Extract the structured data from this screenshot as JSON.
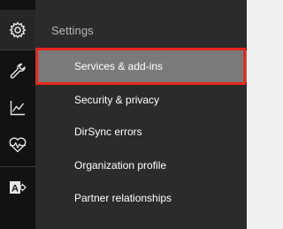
{
  "rail": {
    "items": [
      {
        "icon": "gear-icon"
      },
      {
        "icon": "wrench-icon"
      },
      {
        "icon": "chart-line-icon"
      },
      {
        "icon": "heart-pulse-icon"
      },
      {
        "icon": "exchange-admin-icon",
        "glyph": "A"
      }
    ]
  },
  "flyout": {
    "title": "Settings",
    "items": [
      {
        "label": "Services & add-ins",
        "selected": true
      },
      {
        "label": "Security & privacy"
      },
      {
        "label": "DirSync errors"
      },
      {
        "label": "Organization profile"
      },
      {
        "label": "Partner relationships"
      }
    ]
  },
  "colors": {
    "rail_bg": "#121212",
    "flyout_bg": "#2b2b2b",
    "selected_bg": "#7a7a7a",
    "highlight": "#e8261d"
  }
}
